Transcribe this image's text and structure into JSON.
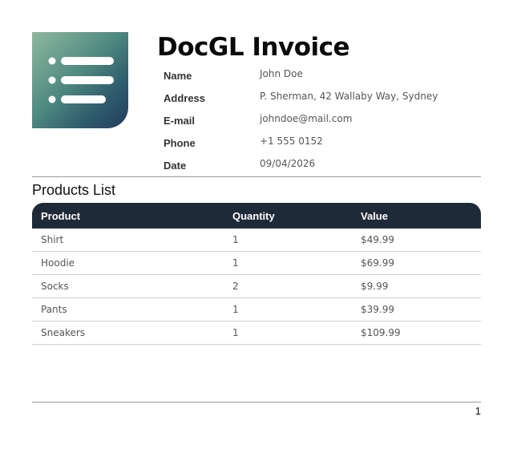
{
  "title": "DocGL Invoice",
  "customer": [
    {
      "label": "Name",
      "value": "John Doe"
    },
    {
      "label": "Address",
      "value": "P. Sherman, 42 Wallaby Way, Sydney"
    },
    {
      "label": "E-mail",
      "value": "johndoe@mail.com"
    },
    {
      "label": "Phone",
      "value": "+1 555 0152"
    },
    {
      "label": "Date",
      "value": "09/04/2026"
    }
  ],
  "products_section_title": "Products List",
  "table": {
    "headers": [
      "Product",
      "Quantity",
      "Value"
    ],
    "rows": [
      [
        "Shirt",
        "1",
        "$49.99"
      ],
      [
        "Hoodie",
        "1",
        "$69.99"
      ],
      [
        "Socks",
        "2",
        "$9.99"
      ],
      [
        "Pants",
        "1",
        "$39.99"
      ],
      [
        "Sneakers",
        "1",
        "$109.99"
      ]
    ]
  },
  "page_number": "1",
  "colors": {
    "table_header_bg": "#1f2a38",
    "logo_gradient_start": "#8fb9a0",
    "logo_gradient_end": "#243d5c"
  },
  "logo_icon": "list-document-icon"
}
